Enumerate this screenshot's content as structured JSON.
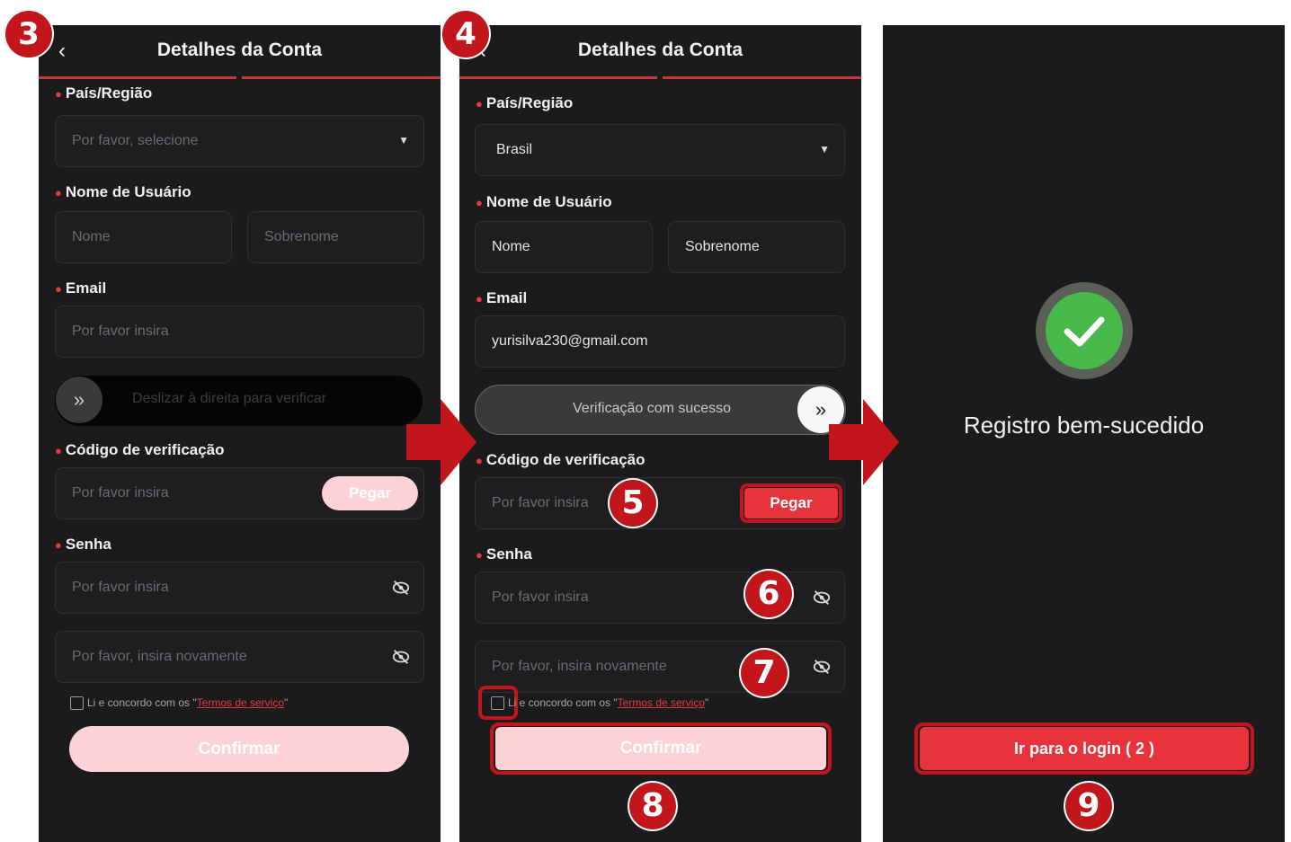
{
  "steps": {
    "s3": "3",
    "s4": "4",
    "s5": "5",
    "s6": "6",
    "s7": "7",
    "s8": "8",
    "s9": "9"
  },
  "form": {
    "title": "Detalhes da Conta",
    "country_label": "País/Região",
    "username_label": "Nome de Usuário",
    "email_label": "Email",
    "code_label": "Código de verificação",
    "password_label": "Senha",
    "get_code": "Pegar",
    "confirm": "Confirmar",
    "terms_prefix": "Li e concordo com os \"",
    "terms_link": "Termos de serviço",
    "terms_suffix": "\""
  },
  "screen_empty": {
    "country_placeholder": "Por favor, selecione",
    "first_name_placeholder": "Nome",
    "last_name_placeholder": "Sobrenome",
    "email_placeholder": "Por favor insira",
    "slider_text": "Deslizar à direita para verificar",
    "code_placeholder": "Por favor insira",
    "password_placeholder": "Por favor insira",
    "password_confirm_placeholder": "Por favor, insira novamente"
  },
  "screen_filled": {
    "country_value": "Brasil",
    "first_name_value": "Nome",
    "last_name_value": "Sobrenome",
    "email_value": "yurisilva230@gmail.com",
    "slider_text": "Verificação com sucesso",
    "code_placeholder": "Por favor insira",
    "password_placeholder": "Por favor insira",
    "password_confirm_placeholder": "Por favor, insira novamente"
  },
  "screen_success": {
    "message": "Registro bem-sucedido",
    "login_button": "Ir para o login ( 2 )"
  },
  "colors": {
    "accent": "#e8323c",
    "accent_faded": "#fdd2d5",
    "background": "#1b1b1d",
    "success": "#46b94a",
    "marker": "#c3161c"
  }
}
